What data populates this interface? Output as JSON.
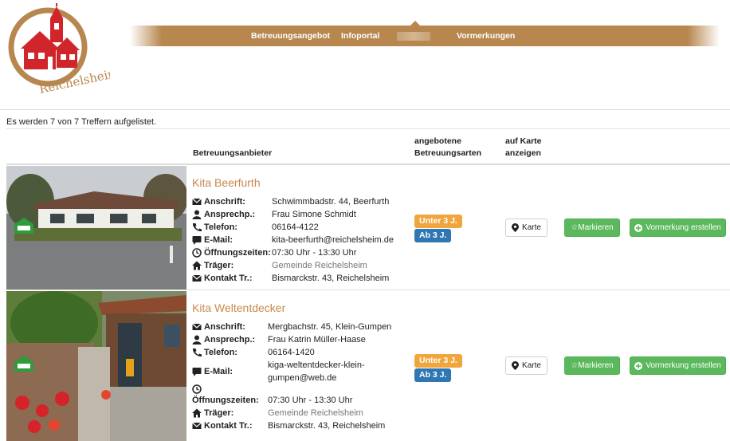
{
  "brand": {
    "logo_text": "Reichelsheim"
  },
  "nav": {
    "items": [
      {
        "label": "Betreuungsangebot"
      },
      {
        "label": "Infoportal"
      },
      {
        "label": "Vormerkungen"
      }
    ]
  },
  "results": {
    "count_text": "Es werden 7 von 7 Treffern aufgelistet."
  },
  "table": {
    "headers": {
      "provider": "Betreuungsanbieter",
      "types": "angebotene Betreuungsarten",
      "map": "auf Karte anzeigen"
    }
  },
  "labels": {
    "address": "Anschrift:",
    "contact": "Ansprechp.:",
    "phone": "Telefon:",
    "email": "E-Mail:",
    "hours": "Öffnungszeiten:",
    "carrier": "Träger:",
    "carrier_contact": "Kontakt Tr.:"
  },
  "buttons": {
    "map": "Karte",
    "mark": "Markieren",
    "reserve": "Vormerkung erstellen"
  },
  "kitas": [
    {
      "name": "Kita Beerfurth",
      "address": "Schwimmbadstr. 44, Beerfurth",
      "contact": "Frau Simone Schmidt",
      "phone": "06164-4122",
      "email": "kita-beerfurth@reichelsheim.de",
      "hours": "07:30 Uhr - 13:30 Uhr",
      "carrier": "Gemeinde Reichelsheim",
      "carrier_contact": "Bismarckstr. 43, Reichelsheim",
      "badges": [
        "Unter 3 J.",
        "Ab 3 J."
      ]
    },
    {
      "name": "Kita Weltentdecker",
      "address": "Mergbachstr. 45, Klein-Gumpen",
      "contact": "Frau Katrin Müller-Haase",
      "phone": "06164-1420",
      "email": "kiga-weltentdecker-klein-gumpen@web.de",
      "hours": "07:30 Uhr - 13:30 Uhr",
      "carrier": "Gemeinde Reichelsheim",
      "carrier_contact": "Bismarckstr. 43, Reichelsheim",
      "badges": [
        "Unter 3 J.",
        "Ab 3 J."
      ]
    }
  ],
  "colors": {
    "nav_bar": "#b8874f",
    "kita_name": "#c8894a",
    "badge_under3": "#f0a63c",
    "badge_over3": "#2f77b4",
    "button_green": "#5cb85c"
  }
}
